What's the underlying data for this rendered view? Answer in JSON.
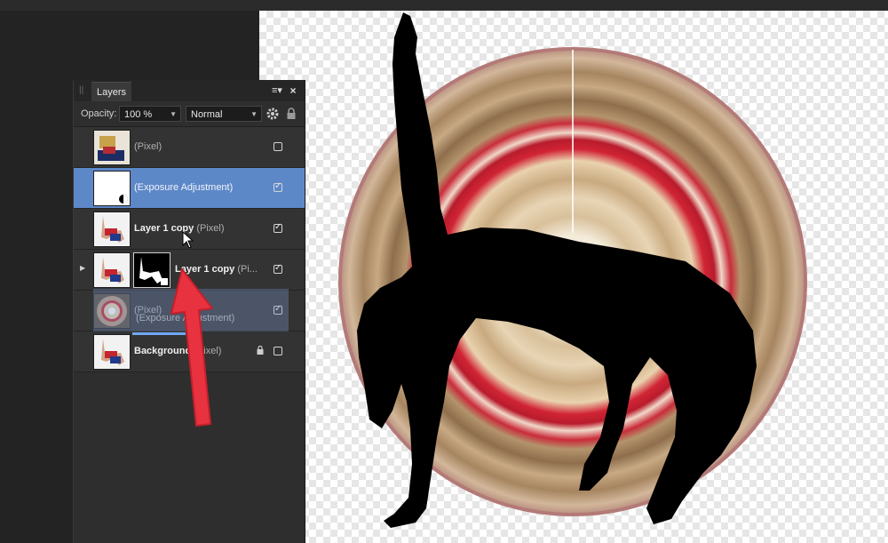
{
  "panel": {
    "tab_label": "Layers",
    "opacity_label": "Opacity:",
    "opacity_value": "100 %",
    "blend_mode": "Normal"
  },
  "layers": [
    {
      "name": "",
      "type": "(Pixel)",
      "visible": false,
      "selected": false
    },
    {
      "name": "",
      "type": "(Exposure Adjustment)",
      "visible": true,
      "selected": true
    },
    {
      "name": "Layer 1 copy",
      "type": "(Pixel)",
      "visible": true,
      "selected": false,
      "dragging": true
    },
    {
      "name": "Layer 1 copy",
      "type": "(Pi...",
      "visible": true,
      "selected": false,
      "has_mask": true,
      "expandable": true
    },
    {
      "name": "",
      "type": "(Pixel)",
      "visible": true,
      "selected": false
    },
    {
      "name": "Background",
      "type": "(Pixel)",
      "visible": false,
      "locked": true,
      "selected": false
    }
  ],
  "drag_ghost_label": "(Exposure Adjustment)",
  "colors": {
    "selection": "#5d88c8",
    "annotation_arrow": "#e8323f",
    "panel_bg": "#2e2e2e"
  },
  "icons": [
    "grip-icon",
    "panel-menu-icon",
    "close-icon",
    "gear-icon",
    "lock-icon",
    "checkbox-icon",
    "expand-arrow-icon",
    "cursor-icon"
  ]
}
